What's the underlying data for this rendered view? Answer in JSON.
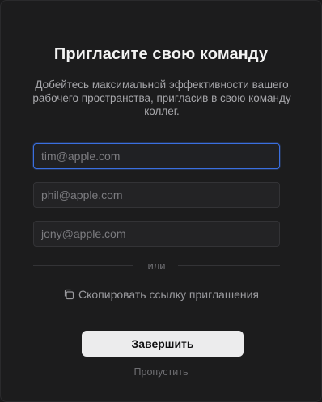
{
  "dialog": {
    "title": "Пригласите свою команду",
    "subtitle": "Добейтесь максимальной эффективности вашего рабочего пространства, пригласив в свою команду коллег.",
    "email_fields": [
      {
        "placeholder": "tim@apple.com",
        "value": ""
      },
      {
        "placeholder": "phil@apple.com",
        "value": ""
      },
      {
        "placeholder": "jony@apple.com",
        "value": ""
      }
    ],
    "divider_text": "или",
    "copy_link": {
      "label": "Скопировать ссылку приглашения",
      "icon": "copy-icon"
    },
    "finish_label": "Завершить",
    "skip_label": "Пропустить"
  },
  "colors": {
    "background": "#1c1c1d",
    "focus_border": "#3a6fe0",
    "primary_button": "#ececed"
  }
}
